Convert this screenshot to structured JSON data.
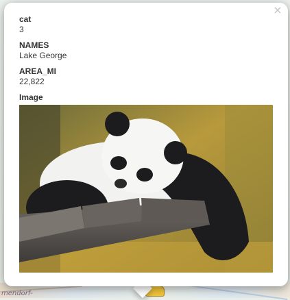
{
  "popup": {
    "close_glyph": "×",
    "fields": [
      {
        "name": "cat",
        "value": "3"
      },
      {
        "name": "NAMES",
        "value": "Lake George"
      },
      {
        "name": "AREA_MI",
        "value": "22,822"
      }
    ],
    "image_label": "Image",
    "image_subject": "panda-photo"
  },
  "map": {
    "label_left": "mendorf-"
  },
  "colors": {
    "popup_bg": "#ffffff",
    "text": "#333333",
    "close": "#c3c3c3"
  }
}
